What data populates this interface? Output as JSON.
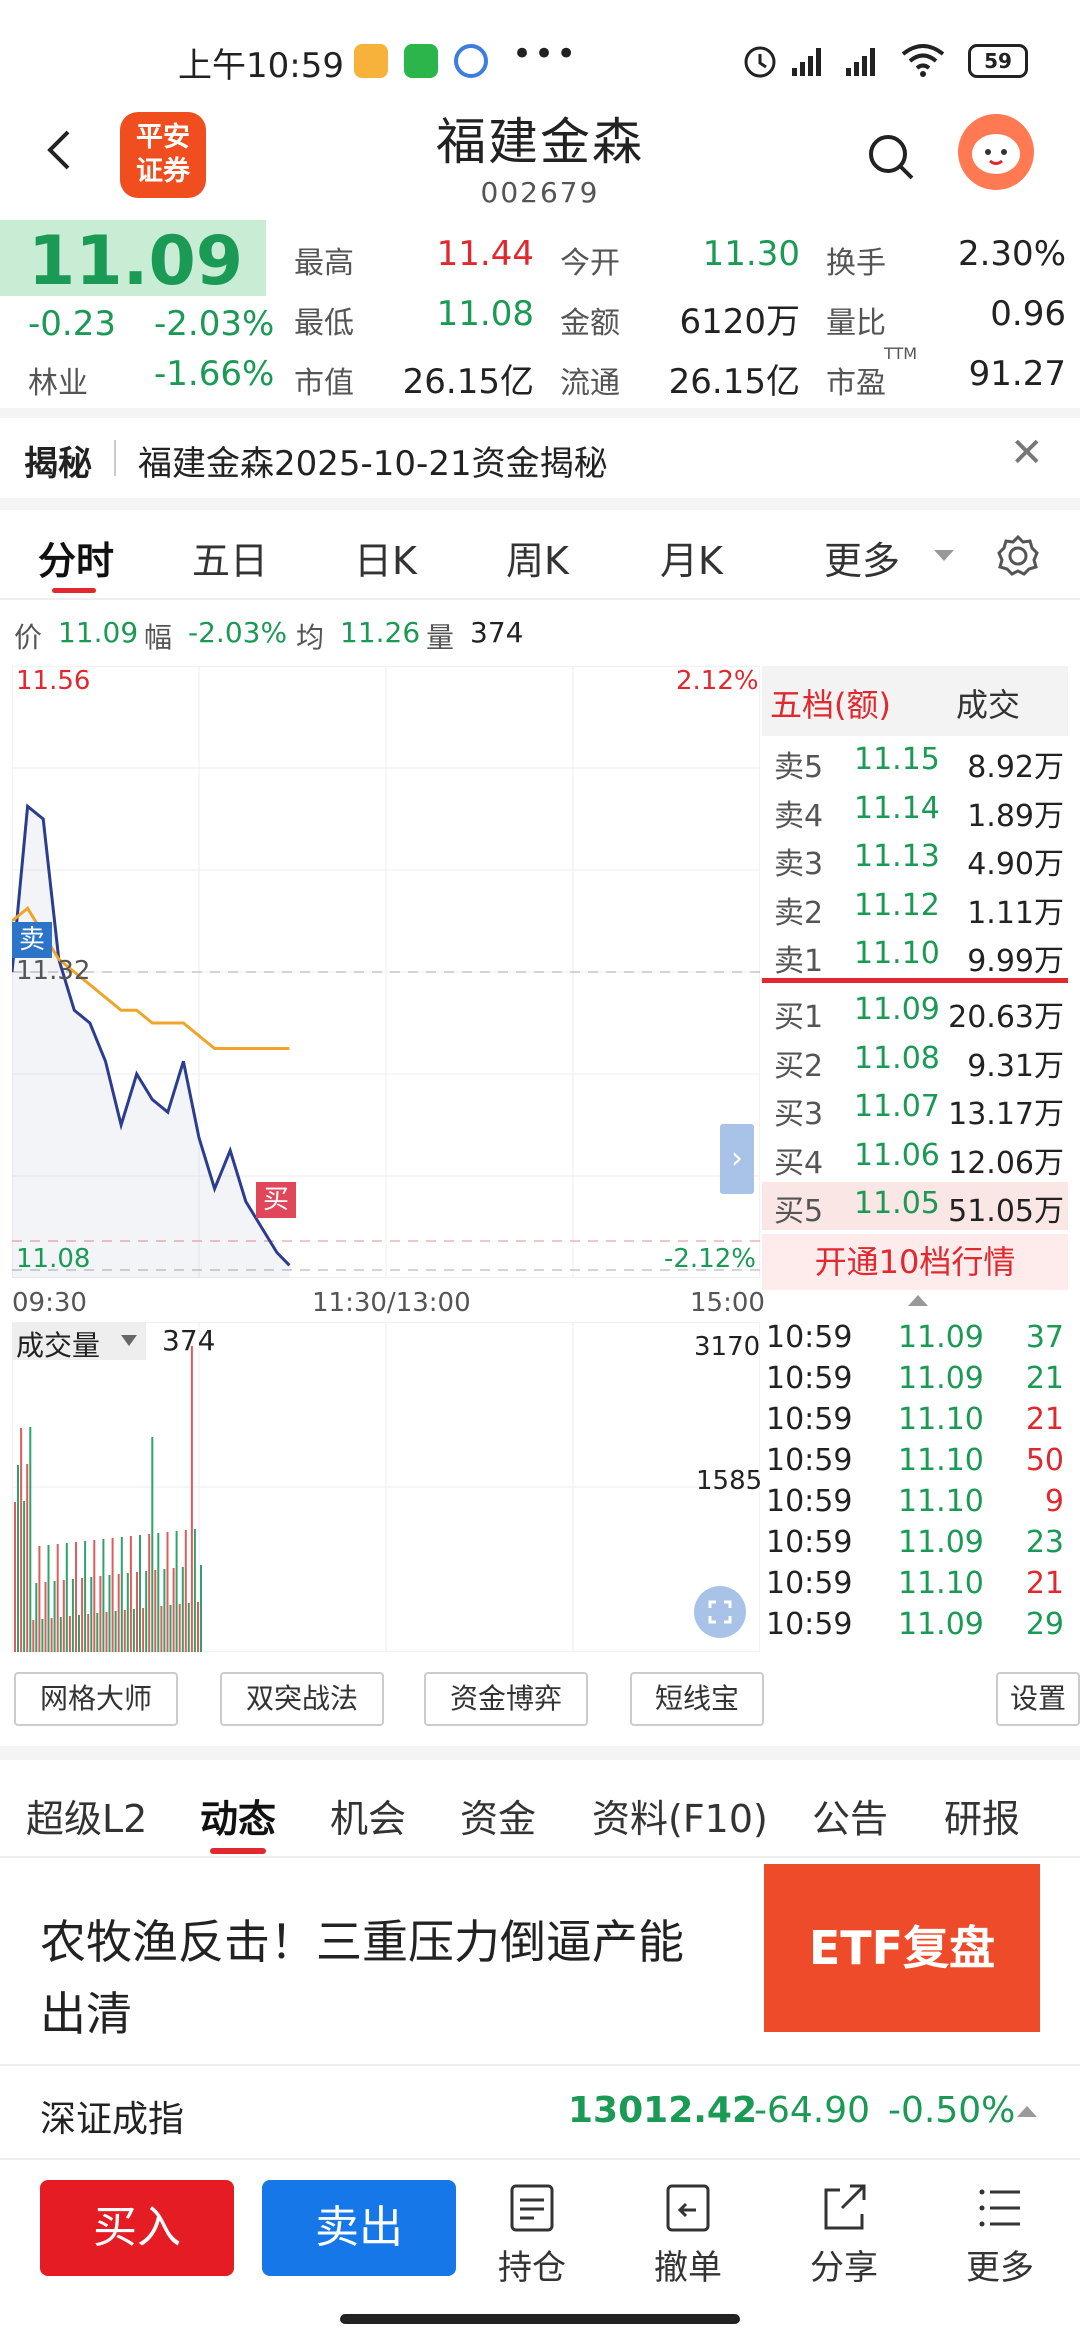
{
  "status_bar": {
    "time": "上午10:59",
    "battery": "59"
  },
  "header": {
    "logo_line1": "平安",
    "logo_line2": "证券",
    "stock_name": "福建金森",
    "stock_code": "002679"
  },
  "quote": {
    "price": "11.09",
    "change": "-0.23",
    "change_pct": "-2.03%",
    "industry_label": "林业",
    "industry_pct": "-1.66%",
    "high_label": "最高",
    "high": "11.44",
    "open_label": "今开",
    "open": "11.30",
    "turnover_label": "换手",
    "turnover": "2.30%",
    "low_label": "最低",
    "low": "11.08",
    "amount_label": "金额",
    "amount": "6120万",
    "vol_ratio_label": "量比",
    "vol_ratio": "0.96",
    "mcap_label": "市值",
    "mcap": "26.15亿",
    "float_label": "流通",
    "float": "26.15亿",
    "pe_label": "市盈",
    "pe_sup": "TTM",
    "pe": "91.27"
  },
  "reveal": {
    "title": "揭秘",
    "text": "福建金森2025-10-21资金揭秘"
  },
  "tabs": [
    "分时",
    "五日",
    "日K",
    "周K",
    "月K",
    "更多"
  ],
  "info": {
    "price_label": "价",
    "price": "11.09",
    "amp_label": "幅",
    "amp": "-2.03%",
    "avg_label": "均",
    "avg": "11.26",
    "vol_label": "量",
    "vol": "374"
  },
  "chart": {
    "top_price": "11.56",
    "top_pct": "2.12%",
    "mid_price": "11.32",
    "bottom_price": "11.08",
    "bottom_pct": "-2.12%",
    "sell_tag": "卖",
    "buy_tag": "买",
    "time_start": "09:30",
    "time_mid": "11:30/13:00",
    "time_end": "15:00",
    "vol_label": "成交量",
    "vol_value": "374",
    "vol_max": "3170",
    "vol_mid": "1585"
  },
  "chart_data": {
    "type": "line",
    "x": [
      "09:30",
      "09:35",
      "09:40",
      "09:45",
      "09:50",
      "09:55",
      "10:00",
      "10:05",
      "10:10",
      "10:15",
      "10:20",
      "10:25",
      "10:30",
      "10:35",
      "10:40",
      "10:45",
      "10:50",
      "10:55",
      "10:59"
    ],
    "series": [
      {
        "values": [
          11.32,
          11.45,
          11.44,
          11.33,
          11.29,
          11.28,
          11.25,
          11.2,
          11.24,
          11.22,
          11.21,
          11.25,
          11.19,
          11.15,
          11.18,
          11.14,
          11.12,
          11.1,
          11.09
        ]
      },
      {
        "values": [
          11.36,
          11.37,
          11.35,
          11.33,
          11.32,
          11.31,
          11.3,
          11.29,
          11.29,
          11.28,
          11.28,
          11.28,
          11.27,
          11.26,
          11.26,
          11.26,
          11.26,
          11.26,
          11.26
        ]
      }
    ],
    "ylim": [
      11.08,
      11.56
    ]
  },
  "book": {
    "head_left": "五档(额)",
    "head_right": "成交",
    "asks": [
      {
        "label": "卖5",
        "price": "11.15",
        "vol": "8.92万"
      },
      {
        "label": "卖4",
        "price": "11.14",
        "vol": "1.89万"
      },
      {
        "label": "卖3",
        "price": "11.13",
        "vol": "4.90万"
      },
      {
        "label": "卖2",
        "price": "11.12",
        "vol": "1.11万"
      },
      {
        "label": "卖1",
        "price": "11.10",
        "vol": "9.99万"
      }
    ],
    "bids": [
      {
        "label": "买1",
        "price": "11.09",
        "vol": "20.63万"
      },
      {
        "label": "买2",
        "price": "11.08",
        "vol": "9.31万"
      },
      {
        "label": "买3",
        "price": "11.07",
        "vol": "13.17万"
      },
      {
        "label": "买4",
        "price": "11.06",
        "vol": "12.06万"
      },
      {
        "label": "买5",
        "price": "11.05",
        "vol": "51.05万"
      }
    ],
    "open_more": "开通10档行情"
  },
  "ticks": [
    {
      "time": "10:59",
      "price": "11.09",
      "vol": "37",
      "color": "#1a9a55"
    },
    {
      "time": "10:59",
      "price": "11.09",
      "vol": "21",
      "color": "#1a9a55"
    },
    {
      "time": "10:59",
      "price": "11.10",
      "vol": "21",
      "color": "#e0282e"
    },
    {
      "time": "10:59",
      "price": "11.10",
      "vol": "50",
      "color": "#e0282e"
    },
    {
      "time": "10:59",
      "price": "11.10",
      "vol": "9",
      "color": "#e0282e"
    },
    {
      "time": "10:59",
      "price": "11.09",
      "vol": "23",
      "color": "#1a9a55"
    },
    {
      "time": "10:59",
      "price": "11.10",
      "vol": "21",
      "color": "#e0282e"
    },
    {
      "time": "10:59",
      "price": "11.09",
      "vol": "29",
      "color": "#1a9a55"
    }
  ],
  "strategies": [
    "网格大师",
    "双突战法",
    "资金博弈",
    "短线宝",
    "设置"
  ],
  "bottom_tabs": [
    "超级L2",
    "动态",
    "机会",
    "资金",
    "资料(F10)",
    "公告",
    "研报"
  ],
  "news": {
    "title": "农牧渔反击！三重压力倒逼产能出清",
    "banner": "ETF复盘"
  },
  "index": {
    "name": "深证成指",
    "value": "13012.42",
    "change": "-64.90",
    "pct": "-0.50%"
  },
  "actions": {
    "buy": "买入",
    "sell": "卖出",
    "hold": "持仓",
    "cancel": "撤单",
    "share": "分享",
    "more": "更多"
  }
}
